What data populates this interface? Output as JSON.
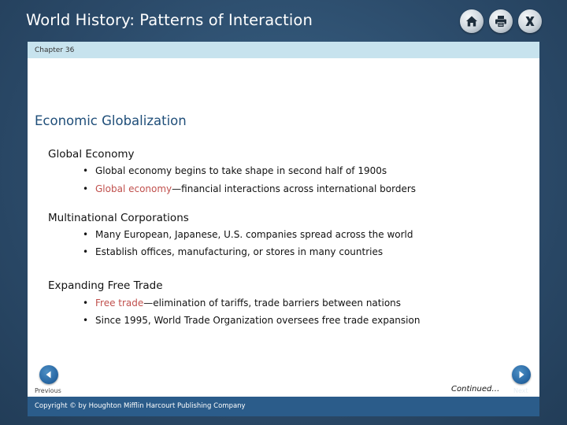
{
  "app": {
    "title": "World History: Patterns of Interaction"
  },
  "toolbar": {
    "home_icon": "home-icon",
    "print_icon": "print-icon",
    "close_icon": "close-icon"
  },
  "chapter": {
    "label": "Chapter 36"
  },
  "slide": {
    "heading": "Economic Globalization",
    "sections": [
      {
        "title": "Global Economy",
        "bullets": [
          {
            "text": "Global economy begins to take shape in second half of 1900s"
          },
          {
            "term": "Global economy",
            "text": "—financial interactions across international borders"
          }
        ]
      },
      {
        "title": "Multinational Corporations",
        "bullets": [
          {
            "text": "Many European, Japanese, U.S. companies spread across the world"
          },
          {
            "text": "Establish offices, manufacturing, or stores in many countries"
          }
        ]
      },
      {
        "title": "Expanding Free Trade",
        "bullets": [
          {
            "term": "Free trade",
            "text": "—elimination of tariffs, trade barriers between nations"
          },
          {
            "text": "Since 1995, World Trade Organization oversees free trade expansion"
          }
        ]
      }
    ],
    "continued": "Continued…"
  },
  "nav": {
    "previous_label": "Previous",
    "next_label": "Next"
  },
  "footer": {
    "copyright": "Copyright © by Houghton Mifflin Harcourt Publishing Company"
  },
  "colors": {
    "background": "#2e4e6e",
    "heading": "#1f4e79",
    "term": "#c0504d",
    "chapter_bar": "#c7e3ee",
    "footer_bar": "#2b5c8a",
    "nav_button": "#2a6aa6"
  }
}
